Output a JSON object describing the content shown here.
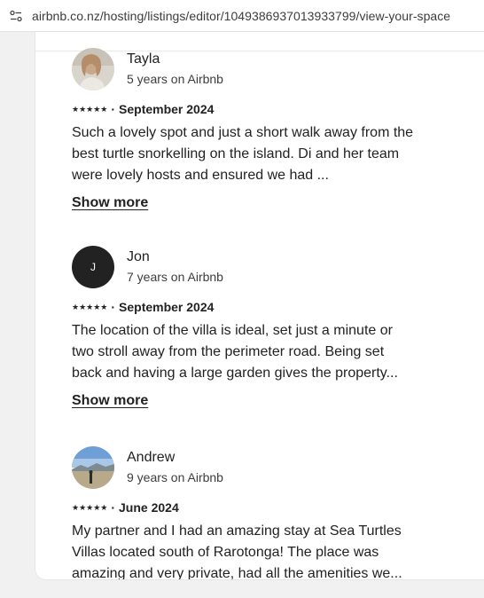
{
  "browser": {
    "url": "airbnb.co.nz/hosting/listings/editor/1049386937013933799/view-your-space"
  },
  "reviews": [
    {
      "name": "Tayla",
      "tenure": "5 years on Airbnb",
      "stars": "★★★★★",
      "date": "September 2024",
      "text": "Such a lovely spot and just a short walk away from the best turtle snorkelling on the island. Di and her team were lovely hosts and ensured we had ...",
      "show_more": "Show more",
      "avatar_type": "photo"
    },
    {
      "name": "Jon",
      "tenure": "7 years on Airbnb",
      "stars": "★★★★★",
      "date": "September 2024",
      "text": "The location of the villa is ideal, set just a minute or two stroll away from the perimeter road. Being set back and having a large garden gives the property...",
      "show_more": "Show more",
      "avatar_initial": "J",
      "avatar_type": "initial"
    },
    {
      "name": "Andrew",
      "tenure": "9 years on Airbnb",
      "stars": "★★★★★",
      "date": "June 2024",
      "text": "My partner and I had an amazing stay at Sea Turtles Villas located south of Rarotonga! The place was amazing and very private, had all the amenities we...",
      "avatar_type": "photo"
    }
  ],
  "separator": "·",
  "colors": {
    "text": "#222222",
    "avatar_dark": "#222222",
    "page_bg": "#f1f1f1"
  }
}
